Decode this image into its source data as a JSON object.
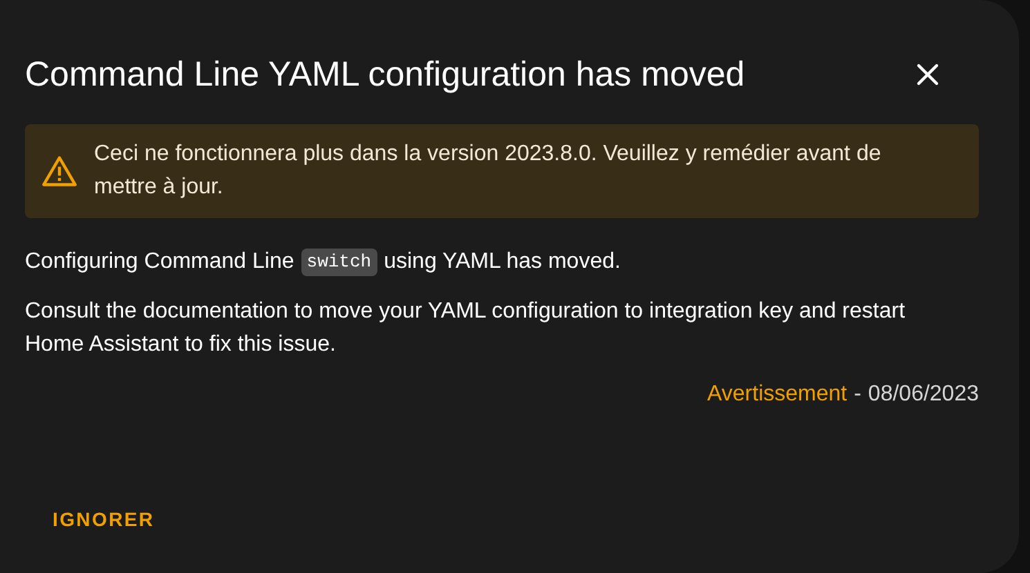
{
  "dialog": {
    "title": "Command Line YAML configuration has moved",
    "alert": {
      "kind": "warning",
      "text": "Ceci ne fonctionnera plus dans la version 2023.8.0. Veuillez y remédier avant de mettre à jour."
    },
    "body": [
      {
        "kind": "code",
        "before": "Configuring Command Line",
        "code": "switch",
        "after": "using YAML has moved."
      },
      {
        "kind": "text",
        "text": "Consult the documentation to move your YAML configuration to integration key and restart Home Assistant to fix this issue."
      }
    ],
    "severity": "Avertissement",
    "separator": "-",
    "date": "08/06/2023",
    "actions": [
      "IGNORER"
    ]
  }
}
